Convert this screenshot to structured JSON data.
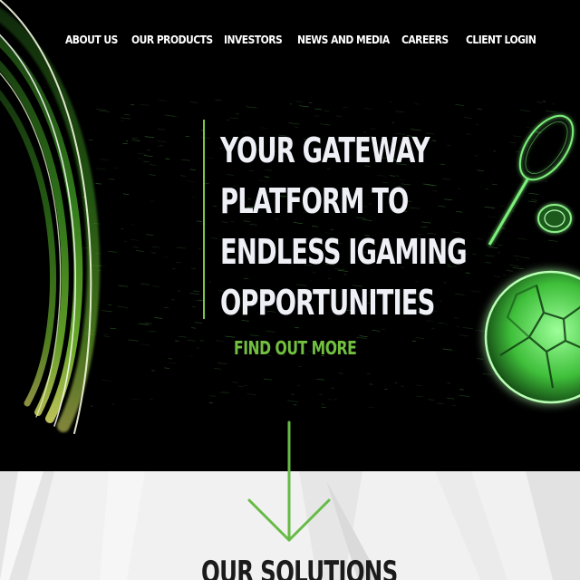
{
  "nav": {
    "items": [
      {
        "label": "ABOUT US"
      },
      {
        "label": "OUR PRODUCTS"
      },
      {
        "label": "INVESTORS"
      },
      {
        "label": "NEWS AND MEDIA"
      },
      {
        "label": "CAREERS"
      },
      {
        "label": "CLIENT LOGIN"
      }
    ]
  },
  "hero": {
    "headline_lines": [
      "YOUR GATEWAY",
      "PLATFORM TO",
      "ENDLESS IGAMING",
      "OPPORTUNITIES"
    ],
    "cta_label": "FIND OUT MORE",
    "decor": {
      "swirl_icon": "green-swirl-graphic",
      "sports_icons": [
        "tennis-racket-icon",
        "coin-icon",
        "soccer-ball-icon"
      ]
    }
  },
  "solutions": {
    "title": "OUR SOLUTIONS",
    "scroll_icon": "arrow-down-icon"
  },
  "colors": {
    "accent_green": "#72c040",
    "hero_background": "#000000",
    "section_background": "#f1f1f1",
    "text_light": "#eef0f6",
    "text_dark": "#1b1b1b"
  }
}
